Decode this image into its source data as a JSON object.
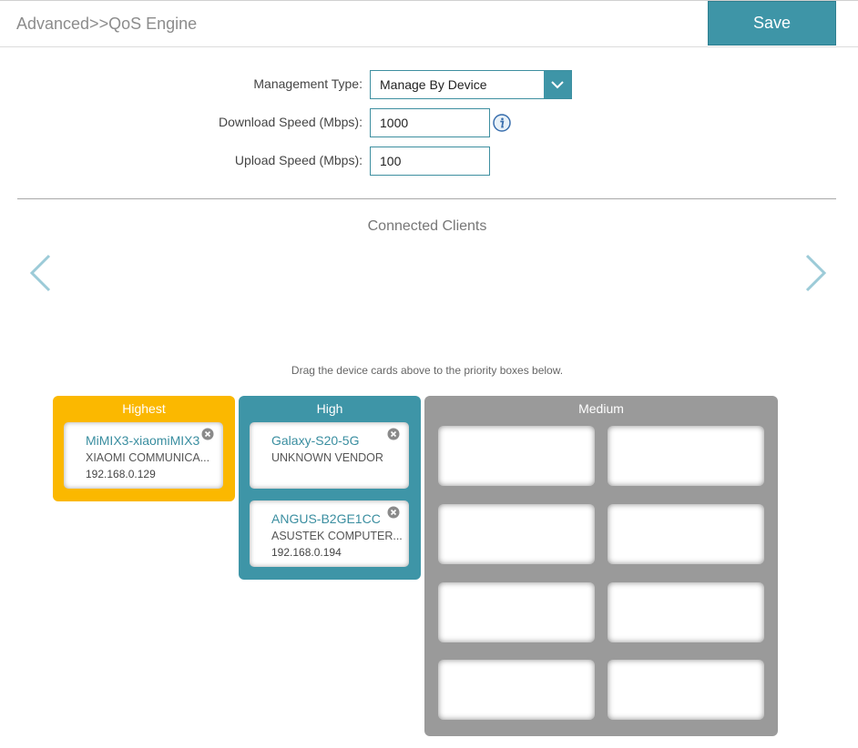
{
  "header": {
    "title": "Advanced>>QoS Engine",
    "save_label": "Save"
  },
  "form": {
    "management_type": {
      "label": "Management Type:",
      "value": "Manage By Device"
    },
    "download_speed": {
      "label": "Download Speed (Mbps):",
      "value": "1000"
    },
    "upload_speed": {
      "label": "Upload Speed (Mbps):",
      "value": "100"
    }
  },
  "clients": {
    "title": "Connected Clients"
  },
  "hint": "Drag the device cards above to the priority boxes below.",
  "priority": {
    "highest": {
      "label": "Highest",
      "color": "#fbb800",
      "devices": [
        {
          "name": "MiMIX3-xiaomiMIX3",
          "vendor": "XIAOMI COMMUNICA...",
          "ip": "192.168.0.129"
        }
      ]
    },
    "high": {
      "label": "High",
      "color": "#3e95a7",
      "devices": [
        {
          "name": "Galaxy-S20-5G",
          "vendor": "UNKNOWN VENDOR",
          "ip": ""
        },
        {
          "name": "ANGUS-B2GE1CC",
          "vendor": "ASUSTEK COMPUTER...",
          "ip": "192.168.0.194"
        }
      ]
    },
    "medium": {
      "label": "Medium",
      "color": "#9a9a9a"
    }
  },
  "icons": {
    "dropdown": "chevron-down-icon",
    "info": "info-icon",
    "prev": "chevron-left-icon",
    "next": "chevron-right-icon",
    "remove": "close-circle-icon"
  }
}
